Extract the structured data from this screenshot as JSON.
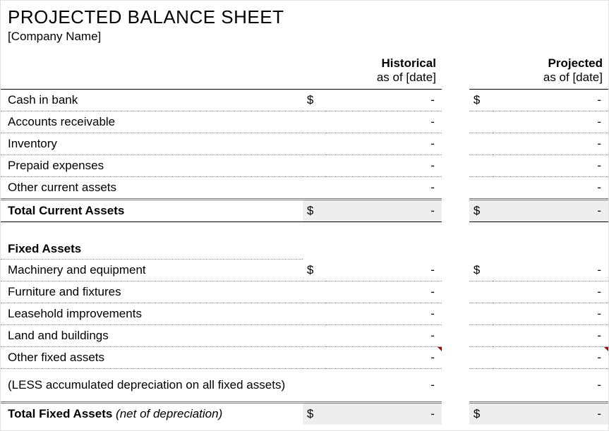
{
  "title": "PROJECTED BALANCE SHEET",
  "company": "[Company Name]",
  "cols": {
    "hist_head": "Historical",
    "hist_sub": "as of [date]",
    "proj_head": "Projected",
    "proj_sub": "as of [date]"
  },
  "currency": "$",
  "dash": "-",
  "current_assets": {
    "rows": [
      {
        "label": "Cash in bank",
        "show_sym": true
      },
      {
        "label": "Accounts receivable",
        "show_sym": false
      },
      {
        "label": "Inventory",
        "show_sym": false
      },
      {
        "label": "Prepaid expenses",
        "show_sym": false
      },
      {
        "label": "Other current assets",
        "show_sym": false
      }
    ],
    "total_label": "Total Current Assets"
  },
  "fixed_assets": {
    "heading": "Fixed Assets",
    "rows": [
      {
        "label": "Machinery and equipment",
        "show_sym": true,
        "tick": false
      },
      {
        "label": "Furniture and fixtures",
        "show_sym": false,
        "tick": false
      },
      {
        "label": "Leasehold improvements",
        "show_sym": false,
        "tick": false
      },
      {
        "label": "Land and buildings",
        "show_sym": false,
        "tick": false
      },
      {
        "label": "Other fixed assets",
        "show_sym": false,
        "tick": true
      },
      {
        "label": "(LESS accumulated depreciation on all fixed assets)",
        "show_sym": false,
        "tick": false,
        "tall": true
      }
    ],
    "total_label_a": "Total Fixed Assets ",
    "total_label_b": "(net of depreciation)"
  }
}
